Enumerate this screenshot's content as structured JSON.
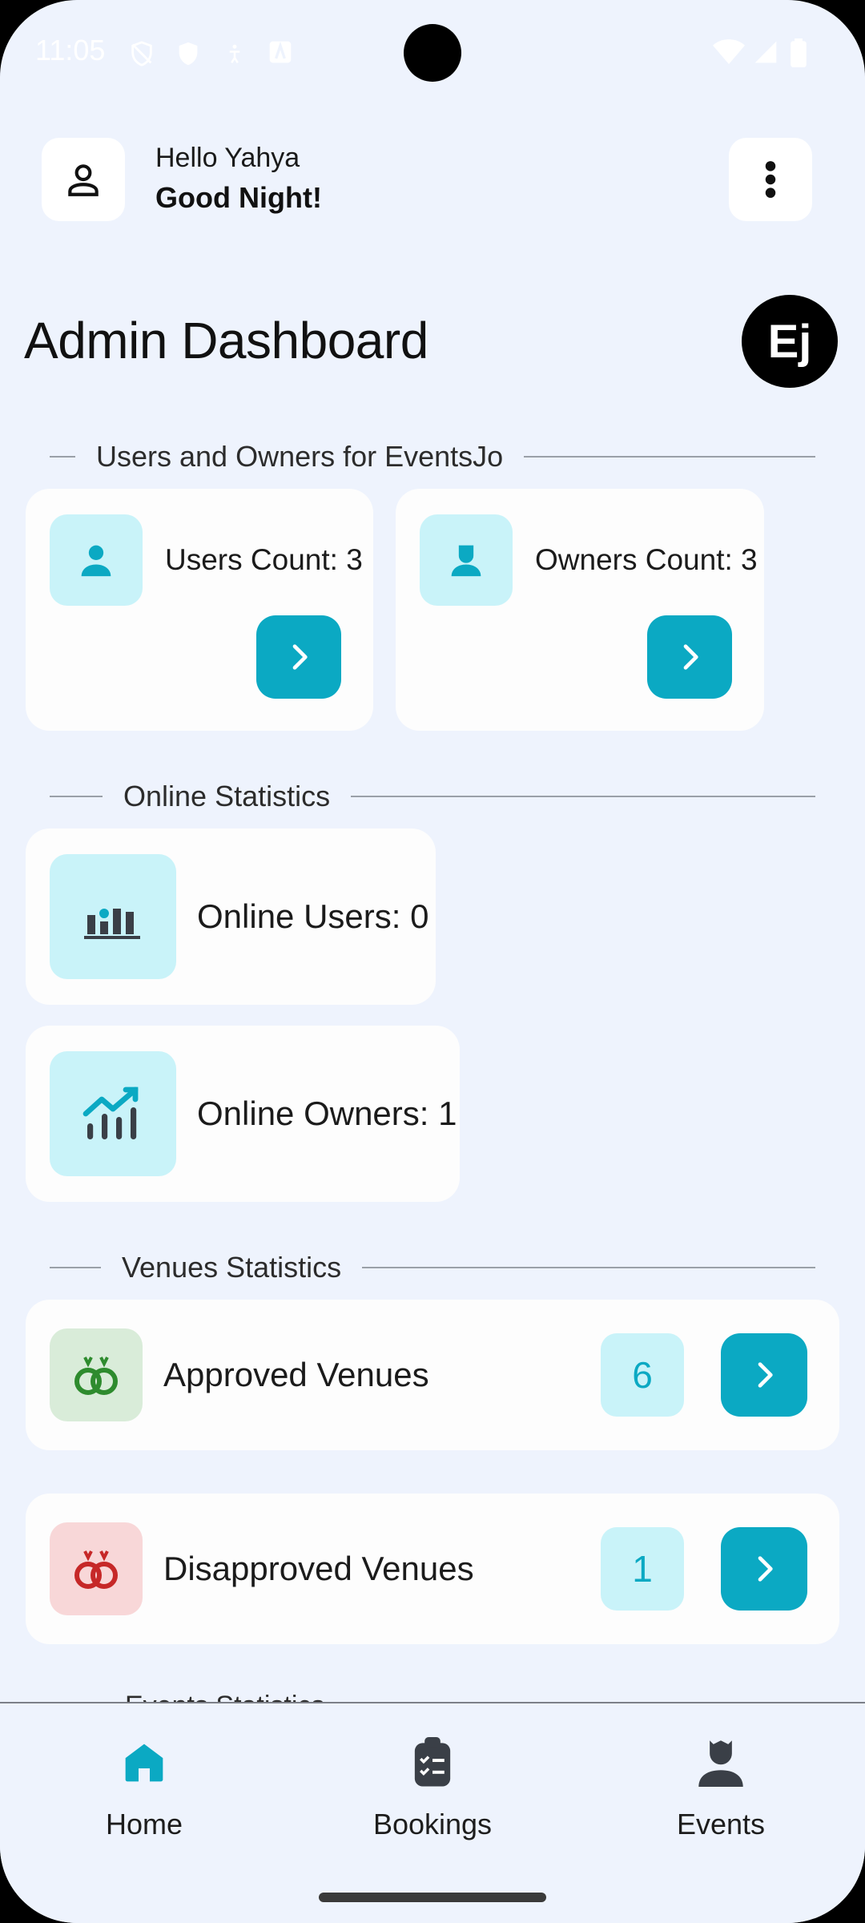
{
  "status_bar": {
    "time": "11:05"
  },
  "header": {
    "hello": "Hello Yahya",
    "greeting": "Good Night!"
  },
  "page_title": "Admin Dashboard",
  "logo_text": "Ej",
  "sections": {
    "users_owners": "Users and Owners for EventsJo",
    "online": "Online Statistics",
    "venues": "Venues Statistics",
    "events": "Events Statistics"
  },
  "cards": {
    "users_count": "Users Count: 3",
    "owners_count": "Owners Count: 3",
    "online_users": "Online Users: 0",
    "online_owners": "Online Owners: 1",
    "approved_venues": {
      "label": "Approved Venues",
      "count": "6"
    },
    "disapproved_venues": {
      "label": "Disapproved Venues",
      "count": "1"
    }
  },
  "bottom_nav": {
    "home": "Home",
    "bookings": "Bookings",
    "events": "Events"
  },
  "colors": {
    "accent": "#0ba9c3",
    "background": "#eef3fd",
    "green_icon": "#2e8b2e",
    "red_icon": "#c62828"
  }
}
